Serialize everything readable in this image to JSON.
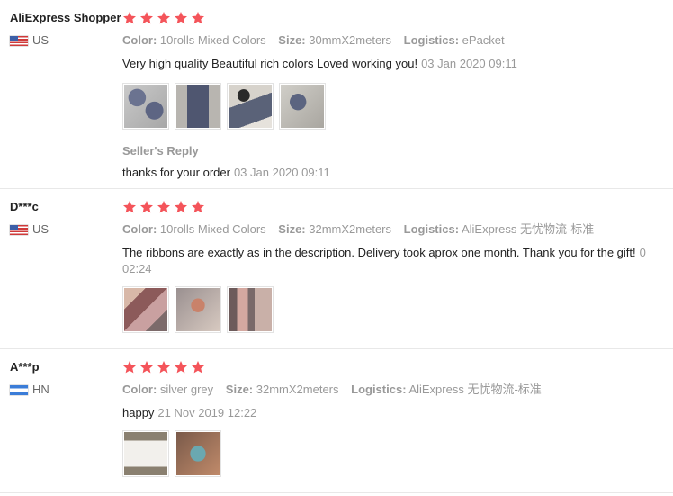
{
  "feedbacks": [
    {
      "user": "AliExpress Shopper",
      "country": "US",
      "rating": 5,
      "color_key": "Color:",
      "color_val": "10rolls Mixed Colors",
      "size_key": "Size:",
      "size_val": "30mmX2meters",
      "logistics_key": "Logistics:",
      "logistics_val": "ePacket",
      "text": "Very high quality Beautiful rich colors Loved working you!",
      "date": "03 Jan 2020 09:11",
      "reply_title": "Seller's Reply",
      "reply_text": "thanks for your order",
      "reply_date": "03 Jan 2020 09:11"
    },
    {
      "user": "D***c",
      "country": "US",
      "rating": 5,
      "color_key": "Color:",
      "color_val": "10rolls Mixed Colors",
      "size_key": "Size:",
      "size_val": "32mmX2meters",
      "logistics_key": "Logistics:",
      "logistics_val": "AliExpress 无忧物流-标准",
      "text": "The ribbons are exactly as in the description. Delivery took aprox one month. Thank you for the gift!",
      "date_line1": "0",
      "date_line2": "02:24"
    },
    {
      "user": "A***p",
      "country": "HN",
      "rating": 5,
      "color_key": "Color:",
      "color_val": "silver grey",
      "size_key": "Size:",
      "size_val": "32mmX2meters",
      "logistics_key": "Logistics:",
      "logistics_val": "AliExpress 无忧物流-标准",
      "text": "happy",
      "date": "21 Nov 2019 12:22"
    }
  ],
  "colors": {
    "star": "#f4545a",
    "muted": "#999999",
    "text": "#222222",
    "divider": "#e8e8e8"
  }
}
